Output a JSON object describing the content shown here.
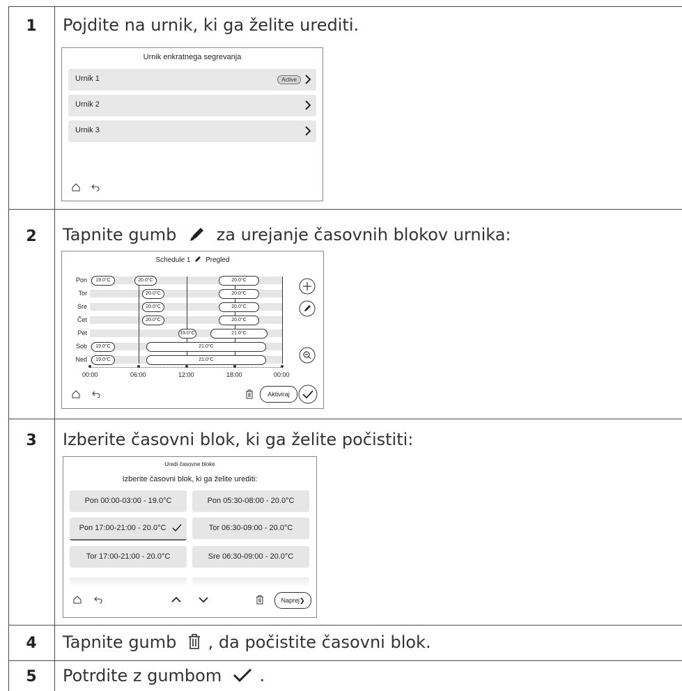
{
  "steps": [
    {
      "number": "1",
      "text": "Pojdite na urnik, ki ga želite urediti."
    },
    {
      "number": "2",
      "text_before": "Tapnite gumb",
      "text_after": "za urejanje časovnih blokov urnika:"
    },
    {
      "number": "3",
      "text": "Izberite časovni blok, ki ga želite počistiti:"
    },
    {
      "number": "4",
      "text_before": "Tapnite gumb",
      "text_after": ", da počistite časovni blok."
    },
    {
      "number": "5",
      "text_before": "Potrdite z gumbom",
      "text_after": "."
    }
  ],
  "screen1": {
    "title": "Urnik enkratnega segrevanja",
    "items": [
      {
        "label": "Urnik 1",
        "badge": "Active"
      },
      {
        "label": "Urnik 2"
      },
      {
        "label": "Urnik 3"
      }
    ],
    "icons": [
      "home-icon",
      "back-icon",
      "chevron-right-icon"
    ]
  },
  "screen2": {
    "title_left": "Schedule 1",
    "title_right": "Pregled",
    "days": [
      "Pon",
      "Tor",
      "Sre",
      "Čet",
      "Pet",
      "Sob",
      "Ned"
    ],
    "time_labels": [
      "00:00",
      "06:00",
      "12:00",
      "18:00",
      "00:00"
    ],
    "blocks": [
      {
        "day": "Pon",
        "label": "19.0°C"
      },
      {
        "day": "Pon",
        "label": "20.0°C"
      },
      {
        "day": "Pon",
        "label": "20.0°C"
      },
      {
        "day": "Tor",
        "label": "20.0°C"
      },
      {
        "day": "Tor",
        "label": "20.0°C"
      },
      {
        "day": "Sre",
        "label": "20.0°C"
      },
      {
        "day": "Sre",
        "label": "20.0°C"
      },
      {
        "day": "Čet",
        "label": "20.0°C"
      },
      {
        "day": "Čet",
        "label": "20.0°C"
      },
      {
        "day": "Pet",
        "label": "19.0°C"
      },
      {
        "day": "Pet",
        "label": "21.0°C"
      },
      {
        "day": "Sob",
        "label": "19.0°C"
      },
      {
        "day": "Sob",
        "label": "21.0°C"
      },
      {
        "day": "Ned",
        "label": "19.0°C"
      },
      {
        "day": "Ned",
        "label": "21.0°C"
      }
    ],
    "activate_label": "Aktiviraj",
    "icons": [
      "plus-icon",
      "pencil-icon",
      "zoom-icon",
      "trash-icon",
      "check-icon",
      "home-icon",
      "back-icon"
    ]
  },
  "screen3": {
    "title": "Uredi časovne bloke",
    "subtitle": "Izberite časovni blok, ki ga želite urediti:",
    "blocks": [
      {
        "label": "Pon 00:00-03:00 - 19.0°C"
      },
      {
        "label": "Pon 05:30-08:00 - 20.0°C"
      },
      {
        "label": "Pon 17:00-21:00 - 20.0°C",
        "selected": true
      },
      {
        "label": "Tor 06:30-09:00 - 20.0°C"
      },
      {
        "label": "Tor 17:00-21:00 - 20.0°C"
      },
      {
        "label": "Sre 06:30-09:00 - 20.0°C"
      }
    ],
    "next_label": "Naprej",
    "icons": [
      "home-icon",
      "back-icon",
      "chevron-up-icon",
      "chevron-down-icon",
      "trash-icon",
      "chevron-right-icon",
      "check-icon"
    ]
  },
  "colors": {
    "grid": "#4a4a4a",
    "row": "#e8e8e8",
    "text": "#222222"
  }
}
